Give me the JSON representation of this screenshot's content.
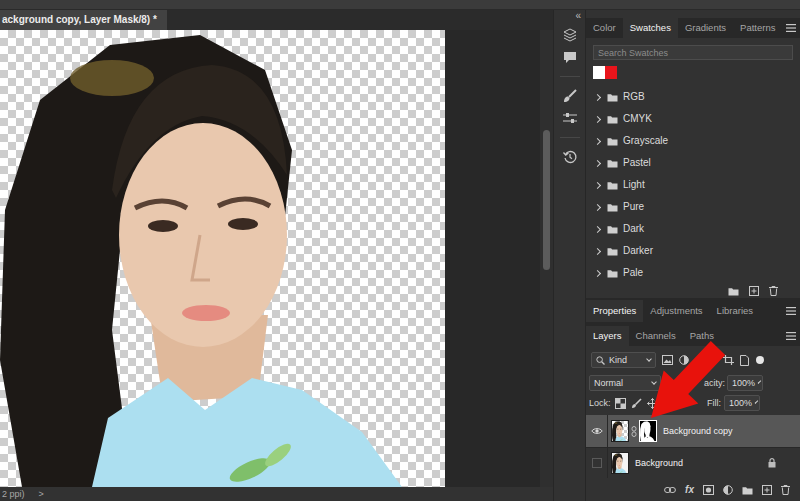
{
  "document": {
    "title": "ackground copy, Layer Mask/8) *",
    "status": "2 ppi)",
    "status_next": ">"
  },
  "toolbar": {
    "collapse": "«"
  },
  "swatches_panel": {
    "tabs": [
      {
        "label": "Color",
        "selected": false
      },
      {
        "label": "Swatches",
        "selected": true
      },
      {
        "label": "Gradients",
        "selected": false
      },
      {
        "label": "Patterns",
        "selected": false
      }
    ],
    "search": {
      "placeholder": "Search Swatches"
    },
    "recent": [
      {
        "color": "#ffffff"
      },
      {
        "color": "#e8141b"
      }
    ],
    "folders": [
      {
        "label": "RGB",
        "expanded": false
      },
      {
        "label": "CMYK",
        "expanded": false
      },
      {
        "label": "Grayscale",
        "expanded": false
      },
      {
        "label": "Pastel",
        "expanded": false
      },
      {
        "label": "Light",
        "expanded": false
      },
      {
        "label": "Pure",
        "expanded": false
      },
      {
        "label": "Dark",
        "expanded": false
      },
      {
        "label": "Darker",
        "expanded": false
      },
      {
        "label": "Pale",
        "expanded": false
      }
    ]
  },
  "properties_tabs": [
    {
      "label": "Properties",
      "selected": true
    },
    {
      "label": "Adjustments",
      "selected": false
    },
    {
      "label": "Libraries",
      "selected": false
    }
  ],
  "layers_panel": {
    "tabs": [
      {
        "label": "Layers",
        "selected": true
      },
      {
        "label": "Channels",
        "selected": false
      },
      {
        "label": "Paths",
        "selected": false
      }
    ],
    "filter": "Kind",
    "blend_mode": "Normal",
    "opacity_label": "acity:",
    "opacity": "100%",
    "lock_label": "Lock:",
    "fill_label": "Fill:",
    "fill": "100%",
    "fx": "fx",
    "layers": [
      {
        "name": "Background copy",
        "visible": true,
        "selected": true,
        "mask": true,
        "locked": false
      },
      {
        "name": "Background",
        "visible": false,
        "selected": false,
        "mask": false,
        "locked": true
      }
    ]
  }
}
